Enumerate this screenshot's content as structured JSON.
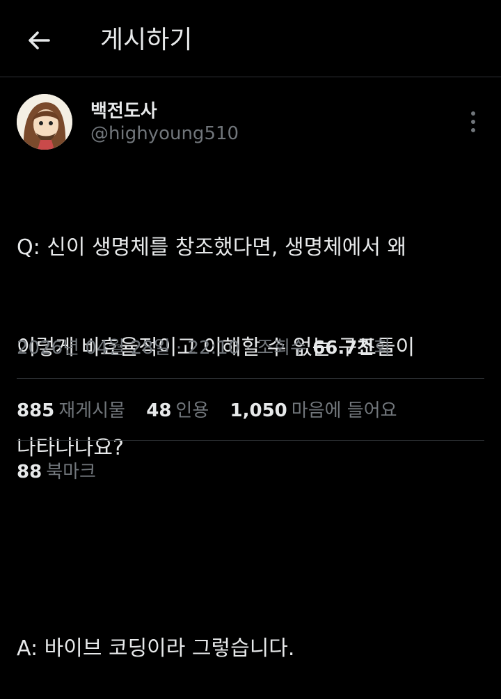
{
  "header": {
    "title": "게시하기"
  },
  "author": {
    "name": "백전도사",
    "handle": "@highyoung510"
  },
  "post": {
    "line1": "Q: 신이 생명체를 창조했다면, 생명체에서 왜",
    "line2": "이렇게 비효율적이고 이해할 수 없는 구조들이",
    "line3": "나타나나요?",
    "line4": "A: 바이브 코딩이라 그렇습니다."
  },
  "meta": {
    "date": "2026년 04월 28일",
    "sep1": " · ",
    "time": "22:10",
    "sep2": " · ",
    "views_label": "조회수 ",
    "views_value": "66.7천",
    "views_suffix": "회"
  },
  "stats": {
    "reposts_count": "885",
    "reposts_label": "재게시물",
    "quotes_count": "48",
    "quotes_label": "인용",
    "likes_count": "1,050",
    "likes_label": "마음에 들어요"
  },
  "bookmarks": {
    "count": "88",
    "label": "북마크"
  },
  "icons": {
    "back": "arrow-left-icon",
    "more": "more-vertical-icon"
  },
  "colors": {
    "background": "#000000",
    "text": "#e7e9ea",
    "muted": "#71767b",
    "divider": "#2f3336"
  }
}
